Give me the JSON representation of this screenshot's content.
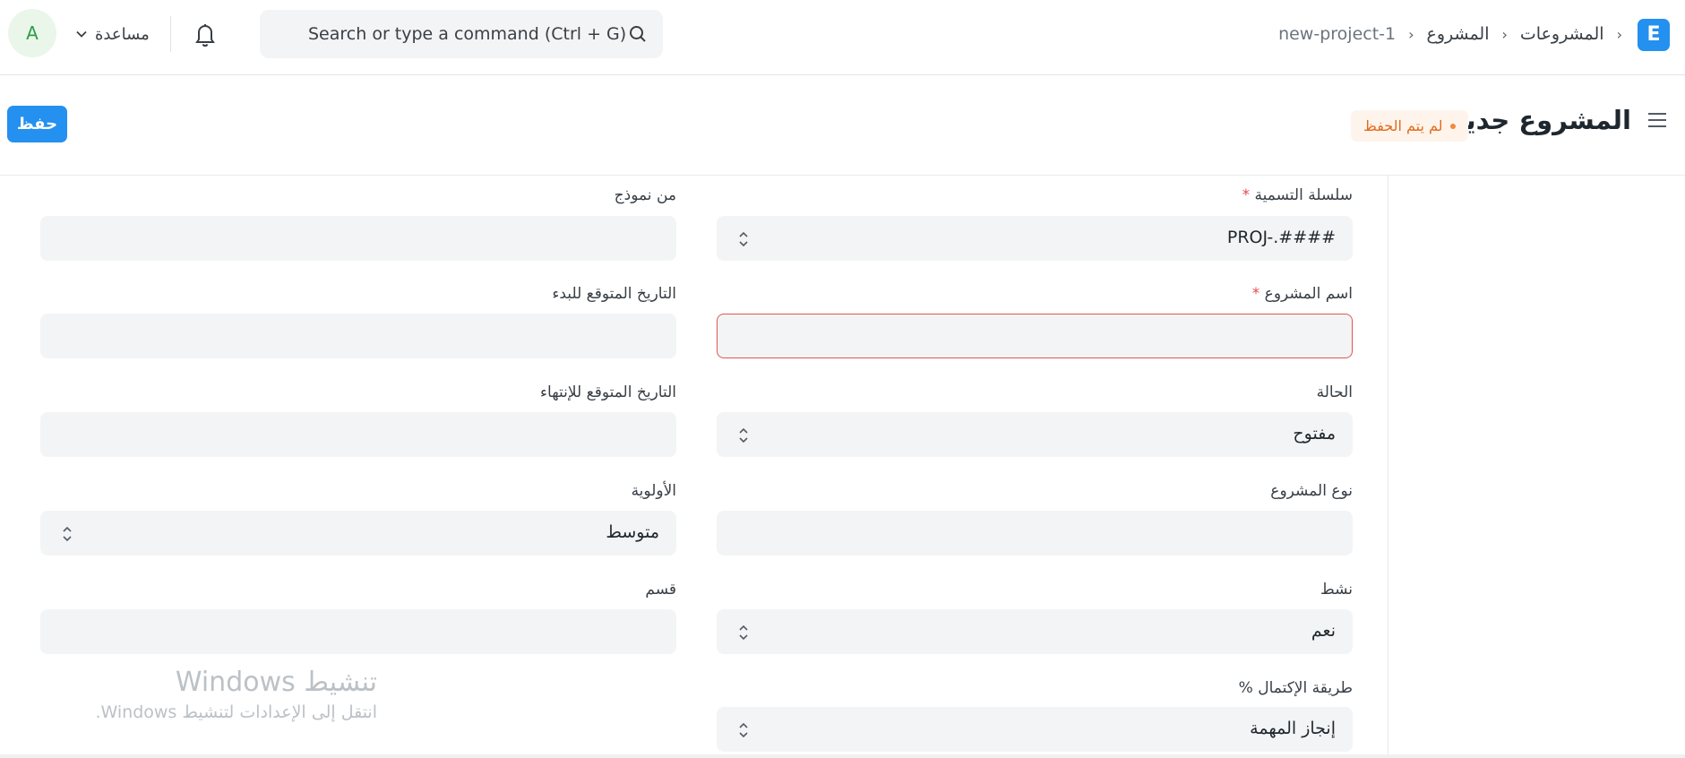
{
  "navbar": {
    "logo": "E",
    "breadcrumbs": [
      "المشروعات",
      "المشروع",
      "new-project-1"
    ],
    "search_placeholder": "Search or type a command (Ctrl + G)",
    "help_label": "مساعدة",
    "avatar_initial": "A"
  },
  "page": {
    "title": "المشروع جديد",
    "status_badge": "لم يتم الحفظ",
    "save_label": "حفظ"
  },
  "form": {
    "naming_series": {
      "label": "سلسلة التسمية",
      "required": "*",
      "value": "PROJ-.####"
    },
    "from_template": {
      "label": "من نموذج",
      "value": ""
    },
    "project_name": {
      "label": "اسم المشروع",
      "required": "*",
      "value": ""
    },
    "expected_start": {
      "label": "التاريخ المتوقع للبدء",
      "value": ""
    },
    "status": {
      "label": "الحالة",
      "value": "مفتوح"
    },
    "expected_end": {
      "label": "التاريخ المتوقع للإنتهاء",
      "value": ""
    },
    "project_type": {
      "label": "نوع المشروع",
      "value": ""
    },
    "priority": {
      "label": "الأولوية",
      "value": "متوسط"
    },
    "is_active": {
      "label": "نشط",
      "value": "نعم"
    },
    "department": {
      "label": "قسم",
      "value": ""
    },
    "completion_method": {
      "label": "طريقة الإكتمال %",
      "value": "إنجاز المهمة"
    }
  },
  "watermark": {
    "title": "تنشيط Windows",
    "subtitle": "انتقل إلى الإعدادات لتنشيط Windows."
  },
  "colors": {
    "primary": "#2490ef",
    "warning_text": "#e06c1a",
    "error_border": "#e25555"
  }
}
